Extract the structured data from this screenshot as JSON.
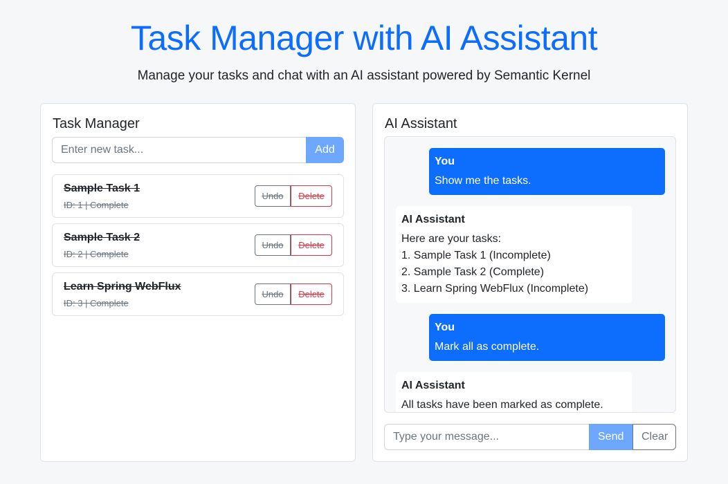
{
  "header": {
    "title": "Task Manager with AI Assistant",
    "subtitle": "Manage your tasks and chat with an AI assistant powered by Semantic Kernel"
  },
  "task_manager": {
    "title": "Task Manager",
    "input_placeholder": "Enter new task...",
    "add_label": "Add",
    "tasks": [
      {
        "name": "Sample Task 1",
        "meta": "ID: 1 | Complete",
        "undo_label": "Undo",
        "delete_label": "Delete"
      },
      {
        "name": "Sample Task 2",
        "meta": "ID: 2 | Complete",
        "undo_label": "Undo",
        "delete_label": "Delete"
      },
      {
        "name": "Learn Spring WebFlux",
        "meta": "ID: 3 | Complete",
        "undo_label": "Undo",
        "delete_label": "Delete"
      }
    ]
  },
  "ai_assistant": {
    "title": "AI Assistant",
    "messages": [
      {
        "sender": "You",
        "lines": [
          "Show me the tasks."
        ]
      },
      {
        "sender": "AI Assistant",
        "lines": [
          "Here are your tasks:",
          "1. Sample Task 1 (Incomplete)",
          "2. Sample Task 2 (Complete)",
          "3. Learn Spring WebFlux (Incomplete)"
        ]
      },
      {
        "sender": "You",
        "lines": [
          "Mark all as complete."
        ]
      },
      {
        "sender": "AI Assistant",
        "lines": [
          "All tasks have been marked as complete."
        ]
      }
    ],
    "input_placeholder": "Type your message...",
    "send_label": "Send",
    "clear_label": "Clear"
  },
  "colors": {
    "primary": "#0d6efd",
    "primary_light": "#6ea8fe",
    "danger": "#dc3545",
    "secondary": "#6c757d",
    "background": "#f6f7f9"
  }
}
